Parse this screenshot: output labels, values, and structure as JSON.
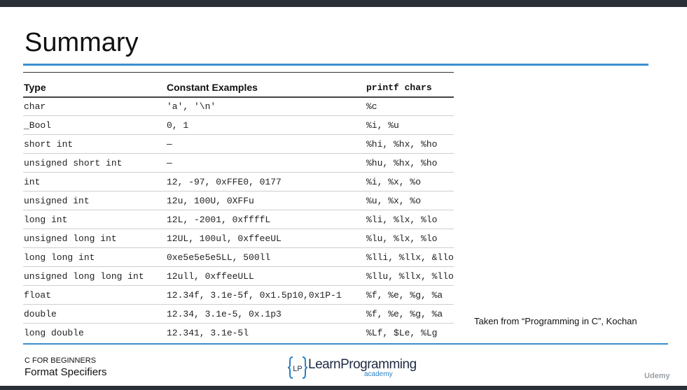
{
  "slide": {
    "title": "Summary",
    "citation": "Taken from “Programming in C”, Kochan"
  },
  "table": {
    "headers": {
      "type": "Type",
      "constants": "Constant Examples",
      "printf": "printf chars"
    },
    "rows": [
      {
        "type": "char",
        "examples": "'a', '\\n'",
        "printf": "%c"
      },
      {
        "type": "_Bool",
        "examples": "0, 1",
        "printf": "%i, %u"
      },
      {
        "type": "short int",
        "examples": "—",
        "printf": "%hi, %hx, %ho"
      },
      {
        "type": "unsigned short int",
        "examples": "—",
        "printf": "%hu, %hx, %ho"
      },
      {
        "type": "int",
        "examples": "12, -97, 0xFFE0, 0177",
        "printf": "%i, %x, %o"
      },
      {
        "type": "unsigned int",
        "examples": "12u, 100U, 0XFFu",
        "printf": "%u, %x, %o"
      },
      {
        "type": "long int",
        "examples": "12L, -2001, 0xffffL",
        "printf": "%li, %lx, %lo"
      },
      {
        "type": "unsigned long int",
        "examples": "12UL, 100ul, 0xffeeUL",
        "printf": "%lu, %lx, %lo"
      },
      {
        "type": "long long int",
        "examples": "0xe5e5e5e5LL, 500ll",
        "printf": "%lli, %llx, &llo"
      },
      {
        "type": "unsigned long long int",
        "examples": "12ull, 0xffeeULL",
        "printf": "%llu, %llx, %llo"
      },
      {
        "type": "float",
        "examples": "12.34f, 3.1e-5f, 0x1.5p10,0x1P-1",
        "printf": "%f, %e, %g, %a"
      },
      {
        "type": "double",
        "examples": "12.34, 3.1e-5, 0x.1p3",
        "printf": "%f, %e, %g, %a"
      },
      {
        "type": "long double",
        "examples": "12.341, 3.1e-5l",
        "printf": "%Lf, $Le, %Lg"
      }
    ]
  },
  "footer": {
    "course": "C FOR BEGINNERS",
    "topic": "Format Specifiers",
    "logo_text": "LearnProgramming",
    "logo_sub": "academy",
    "logo_mark": "LP",
    "watermark": "Udemy"
  },
  "colors": {
    "accent": "#3b8fd0",
    "bar": "#2b2f36"
  }
}
